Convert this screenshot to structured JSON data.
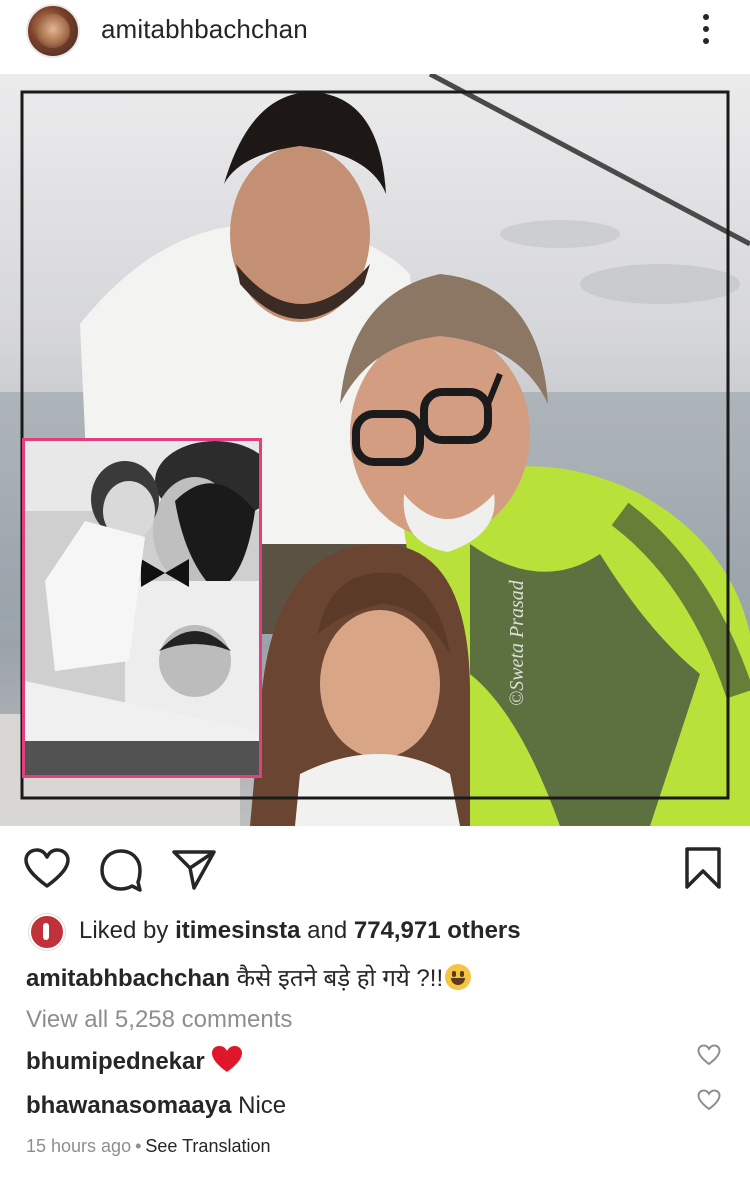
{
  "header": {
    "username": "amitabhbachchan",
    "more_icon": "more-vertical-icon"
  },
  "post": {
    "image_alt": "Family photo on a boat with inset childhood photo",
    "watermark": "©Sweta Prasad"
  },
  "actions": {
    "like_icon": "heart-icon",
    "comment_icon": "comment-icon",
    "share_icon": "send-icon",
    "save_icon": "bookmark-icon"
  },
  "likes": {
    "prefix": "Liked by ",
    "user": "itimesinsta",
    "middle": " and ",
    "count": "774,971 others"
  },
  "caption": {
    "username": "amitabhbachchan",
    "text": " कैसे इतने बड़े हो गये ?!!"
  },
  "comments_link": "View all 5,258 comments",
  "comments": [
    {
      "username": "bhumipednekar",
      "text": ""
    },
    {
      "username": "bhawanasomaaya",
      "text": " Nice"
    }
  ],
  "meta": {
    "time": "15 hours ago",
    "separator": "•",
    "translate": "See Translation"
  },
  "colors": {
    "text": "#262626",
    "muted": "#8e8e8e",
    "inset_border": "#e0407d",
    "heart_red": "#ed4956"
  }
}
